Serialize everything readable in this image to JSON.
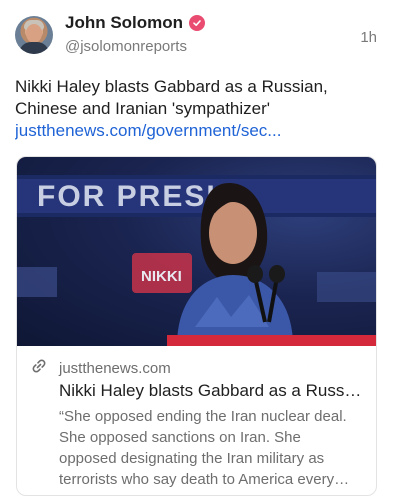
{
  "author": {
    "name": "John Solomon",
    "handle": "@jsolomonreports",
    "time": "1h",
    "avatar_icon": "user-avatar"
  },
  "post": {
    "text": "Nikki Haley blasts Gabbard as a Russian, Chinese and Iranian 'sympathizer'",
    "link": "justthenews.com/government/sec..."
  },
  "card": {
    "image_sign_text": "FOR PRESID",
    "image_sign_text2": "NIKKI",
    "domain": "justthenews.com",
    "title": "Nikki Haley blasts Gabbard as a Russi...",
    "description": "“She opposed ending the Iran nuclear deal. She opposed sanctions on Iran. She opposed designating the Iran military as terrorists who say death to America every single day,” Hal..."
  },
  "colors": {
    "verified": "#e94c70",
    "link": "#1f63d6",
    "muted": "#7a7a7a"
  }
}
